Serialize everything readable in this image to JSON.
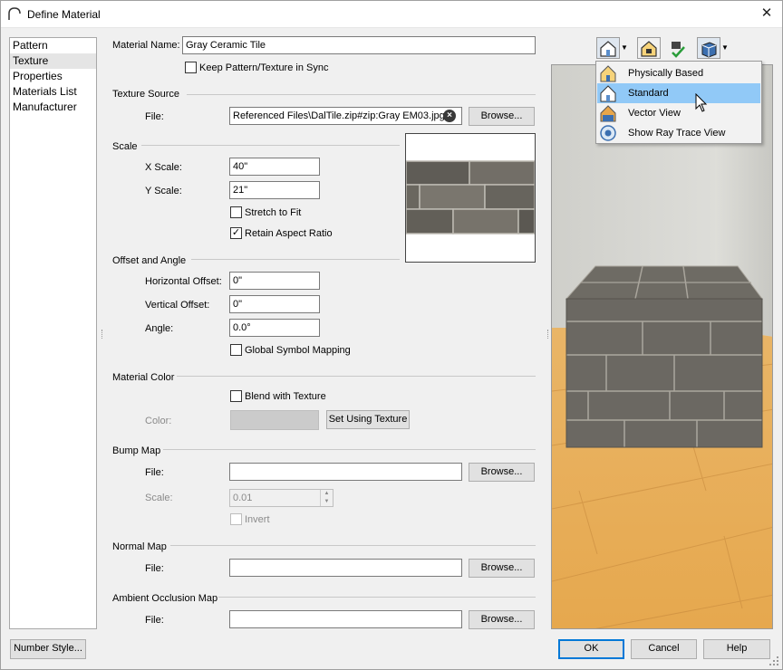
{
  "window": {
    "title": "Define Material",
    "close_glyph": "✕"
  },
  "nav": {
    "items": [
      {
        "label": "Pattern",
        "selected": false
      },
      {
        "label": "Texture",
        "selected": true
      },
      {
        "label": "Properties",
        "selected": false
      },
      {
        "label": "Materials List",
        "selected": false
      },
      {
        "label": "Manufacturer",
        "selected": false
      }
    ]
  },
  "material": {
    "name_label": "Material Name:",
    "name_value": "Gray Ceramic Tile",
    "keep_sync_label": "Keep Pattern/Texture in Sync",
    "keep_sync_checked": false
  },
  "texture_source": {
    "section": "Texture Source",
    "file_label": "File:",
    "file_value": "Referenced Files\\DalTile.zip#zip:Gray EM03.jpg",
    "browse_label": "Browse..."
  },
  "scale": {
    "section": "Scale",
    "x_label": "X Scale:",
    "x_value": "40\"",
    "y_label": "Y Scale:",
    "y_value": "21\"",
    "stretch_label": "Stretch to Fit",
    "stretch_checked": false,
    "retain_label": "Retain Aspect Ratio",
    "retain_checked": true
  },
  "offset": {
    "section": "Offset and Angle",
    "h_label": "Horizontal Offset:",
    "h_value": "0\"",
    "v_label": "Vertical Offset:",
    "v_value": "0\"",
    "angle_label": "Angle:",
    "angle_value": "0.0°",
    "global_label": "Global Symbol Mapping",
    "global_checked": false
  },
  "material_color": {
    "section": "Material Color",
    "blend_label": "Blend with Texture",
    "blend_checked": false,
    "color_label": "Color:",
    "set_using_label": "Set Using Texture"
  },
  "bump_map": {
    "section": "Bump Map",
    "file_label": "File:",
    "file_value": "",
    "browse_label": "Browse...",
    "scale_label": "Scale:",
    "scale_value": "0.01",
    "invert_label": "Invert"
  },
  "normal_map": {
    "section": "Normal Map",
    "file_label": "File:",
    "file_value": "",
    "browse_label": "Browse..."
  },
  "ao_map": {
    "section": "Ambient Occlusion Map",
    "file_label": "File:",
    "file_value": "",
    "browse_label": "Browse..."
  },
  "render_menu": {
    "items": [
      {
        "label": "Physically Based",
        "icon": "house-pbr-icon",
        "highlighted": false
      },
      {
        "label": "Standard",
        "icon": "house-standard-icon",
        "highlighted": true
      },
      {
        "label": "Vector View",
        "icon": "house-vector-icon",
        "highlighted": false
      },
      {
        "label": "Show Ray Trace View",
        "icon": "ray-trace-icon",
        "highlighted": false
      }
    ]
  },
  "footer": {
    "number_style_label": "Number Style...",
    "ok_label": "OK",
    "cancel_label": "Cancel",
    "help_label": "Help"
  },
  "colors": {
    "accent": "#0078d7",
    "menu_highlight": "#91c9f7",
    "tile_gray": "#6f6c66",
    "floor_wood": "#e8b466",
    "wall_back": "#d9d9d4"
  }
}
